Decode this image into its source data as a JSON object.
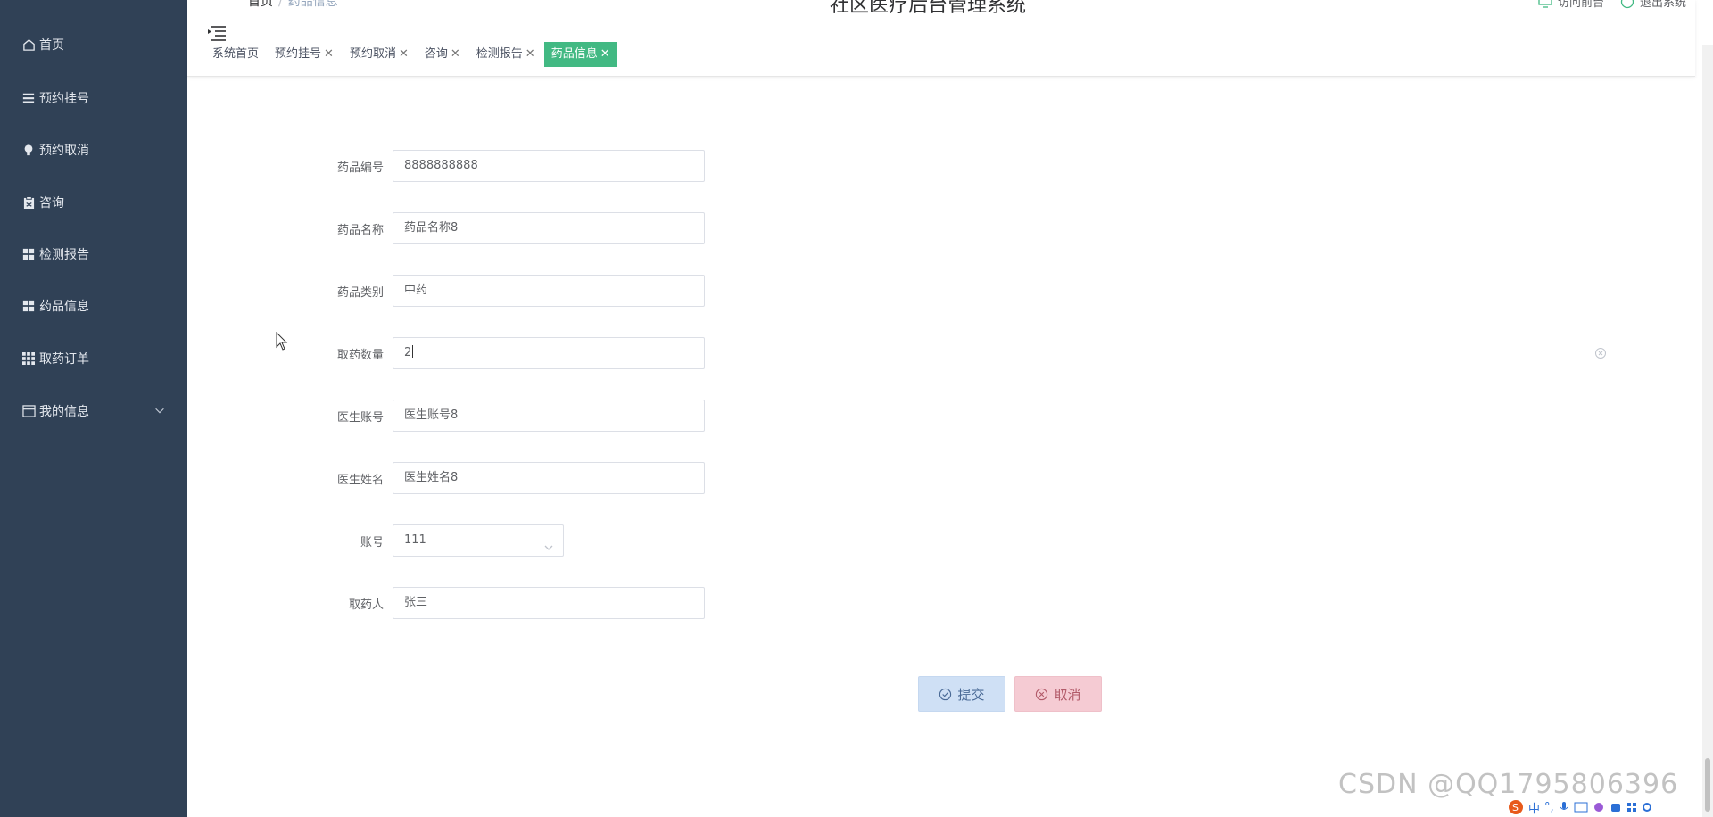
{
  "header": {
    "breadcrumb_home": "首页",
    "breadcrumb_sep": "/",
    "breadcrumb_current": "药品信息",
    "app_title": "社区医疗后台管理系统",
    "link_front": "访问前台",
    "link_logout": "退出系统"
  },
  "sidebar": {
    "items": [
      {
        "label": "首页",
        "icon": "home-icon"
      },
      {
        "label": "预约挂号",
        "icon": "list-icon"
      },
      {
        "label": "预约取消",
        "icon": "bulb-icon"
      },
      {
        "label": "咨询",
        "icon": "clipboard-icon"
      },
      {
        "label": "检测报告",
        "icon": "grid-icon"
      },
      {
        "label": "药品信息",
        "icon": "grid-icon"
      },
      {
        "label": "取药订单",
        "icon": "grid9-icon"
      },
      {
        "label": "我的信息",
        "icon": "window-icon"
      }
    ]
  },
  "tabs": [
    {
      "label": "系统首页",
      "closable": false
    },
    {
      "label": "预约挂号",
      "closable": true
    },
    {
      "label": "预约取消",
      "closable": true
    },
    {
      "label": "咨询",
      "closable": true
    },
    {
      "label": "检测报告",
      "closable": true
    },
    {
      "label": "药品信息",
      "closable": true,
      "active": true
    }
  ],
  "tab_close": "✕",
  "form": {
    "fields": [
      {
        "label": "药品编号",
        "value": "8888888888"
      },
      {
        "label": "药品名称",
        "value": "药品名称8"
      },
      {
        "label": "药品类别",
        "value": "中药"
      },
      {
        "label": "取药数量",
        "value": "2"
      },
      {
        "label": "医生账号",
        "value": "医生账号8"
      },
      {
        "label": "医生姓名",
        "value": "医生姓名8"
      },
      {
        "label": "账号",
        "value": "111"
      },
      {
        "label": "取药人",
        "value": "张三"
      }
    ],
    "submit_label": "提交",
    "cancel_label": "取消"
  },
  "watermark": "CSDN @QQ1795806396",
  "ime": {
    "char": "中",
    "dot": "°,"
  },
  "colors": {
    "sidebar_bg": "#304156",
    "active_tab": "#42b983",
    "submit_bg": "#cfe0f5",
    "cancel_bg": "#f5cbd3"
  }
}
